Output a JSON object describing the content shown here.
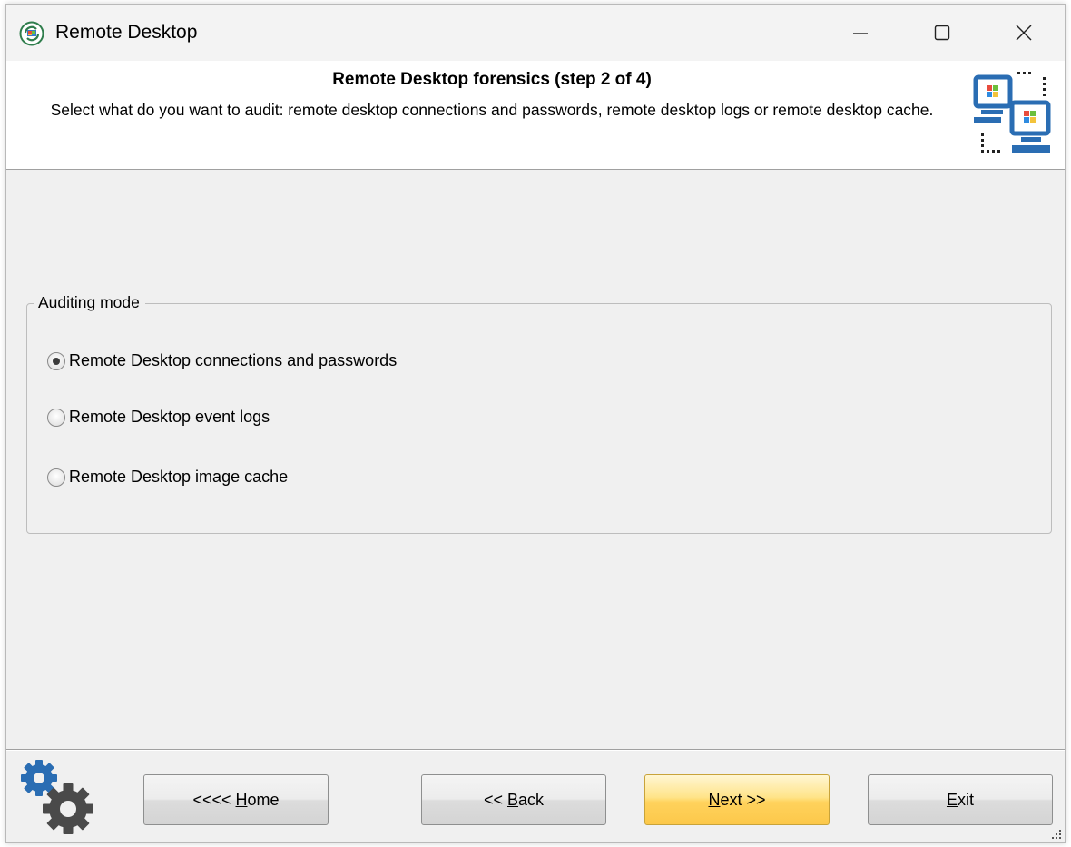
{
  "window": {
    "title": "Remote Desktop",
    "controls": {
      "minimize": "minimize",
      "maximize": "maximize",
      "close": "close"
    }
  },
  "header": {
    "title": "Remote Desktop forensics (step 2 of 4)",
    "description": "Select what do you want to audit: remote desktop connections and passwords, remote desktop logs or remote desktop cache."
  },
  "audit_group": {
    "legend": "Auditing mode",
    "options": [
      {
        "label": "Remote Desktop connections and passwords",
        "checked": true
      },
      {
        "label": "Remote Desktop event logs",
        "checked": false
      },
      {
        "label": "Remote Desktop image cache",
        "checked": false
      }
    ]
  },
  "buttons": {
    "home": {
      "prefix": "<<<< ",
      "mnemonic": "H",
      "rest": "ome"
    },
    "back": {
      "prefix": "<< ",
      "mnemonic": "B",
      "rest": "ack"
    },
    "next": {
      "prefix": "",
      "mnemonic": "N",
      "rest": "ext >>"
    },
    "exit": {
      "prefix": "",
      "mnemonic": "E",
      "rest": "xit"
    }
  },
  "colors": {
    "window_bg": "#f0f0f0",
    "header_bg": "#ffffff",
    "primary_button": "#ffd25c",
    "icon_blue": "#2a6db3"
  },
  "icons": {
    "app": "remote-desktop-app-icon",
    "header": "networked-computers-icon",
    "footer": "gears-icon"
  }
}
